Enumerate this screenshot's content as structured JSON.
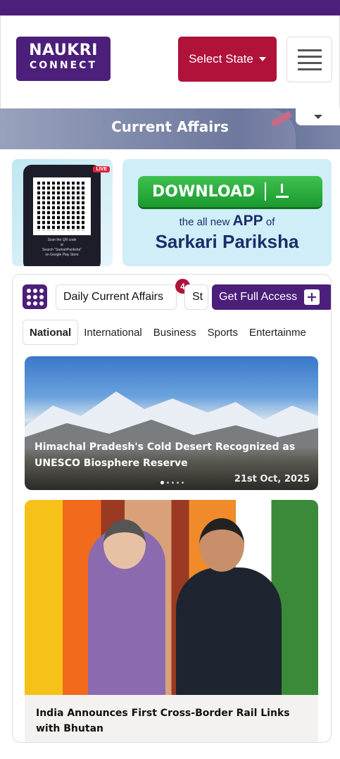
{
  "header": {
    "logo_line1": "NAUKRI",
    "logo_line2": "CONNECT",
    "select_state_label": "Select State"
  },
  "banner": {
    "title": "Current Affairs"
  },
  "promo": {
    "qr_caption_line1": "Scan the QR code",
    "qr_caption_line2": "or",
    "qr_caption_line3": "Search \"SarkariPariksha\"",
    "qr_caption_line4": "on Google Play Store",
    "live_badge": "LIVE",
    "download_label": "DOWNLOAD",
    "app_sub_prefix": "the all new",
    "app_sub_bold": "APP",
    "app_sub_suffix": "of",
    "app_name": "Sarkari Pariksha"
  },
  "chips": {
    "daily_label": "Daily Current Affairs",
    "daily_badge": "4",
    "next_label": "St",
    "access_label": "Get Full Access"
  },
  "tabs": [
    "National",
    "International",
    "Business",
    "Sports",
    "Entertainme"
  ],
  "cards": [
    {
      "title": "Himachal Pradesh's Cold Desert Recognized as UNESCO Biosphere Reserve",
      "date": "21st Oct, 2025"
    },
    {
      "title": "India Announces First Cross-Border Rail Links with Bhutan"
    }
  ]
}
